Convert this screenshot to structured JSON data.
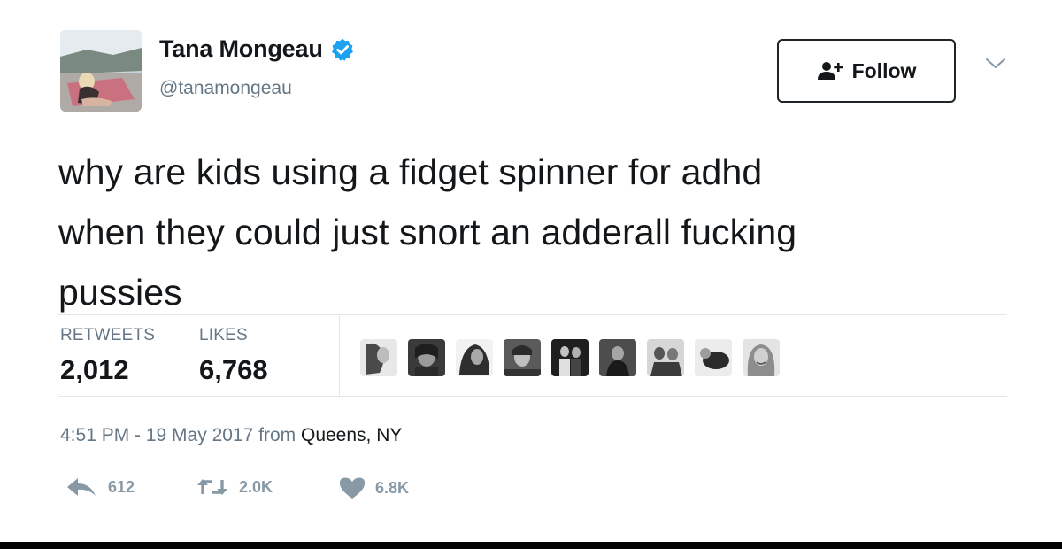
{
  "user": {
    "display_name": "Tana Mongeau",
    "handle": "@tanamongeau",
    "verified": true
  },
  "follow_button": {
    "label": "Follow",
    "icon": "add-user-icon"
  },
  "menu": {
    "icon": "chevron-down-icon"
  },
  "tweet": {
    "lines": [
      "why are kids using a fidget spinner for adhd",
      "when they could just snort an adderall fucking",
      "pussies"
    ]
  },
  "stats": {
    "retweets_label": "RETWEETS",
    "retweets_value": "2,012",
    "likes_label": "LIKES",
    "likes_value": "6,768"
  },
  "likers": {
    "count": 9,
    "icon": "avatar-icon"
  },
  "meta": {
    "time_date": "4:51 PM - 19 May 2017",
    "from_word": "from",
    "place": "Queens, NY"
  },
  "actions": {
    "reply": {
      "icon": "reply-icon",
      "count": "612"
    },
    "retweet": {
      "icon": "retweet-icon",
      "count": "2.0K"
    },
    "like": {
      "icon": "heart-icon",
      "count": "6.8K"
    }
  },
  "colors": {
    "verified_blue": "#1da1f2",
    "text_primary": "#14171a",
    "text_secondary": "#657786",
    "action_gray": "#8899a6",
    "divider": "#e1e8ed"
  }
}
